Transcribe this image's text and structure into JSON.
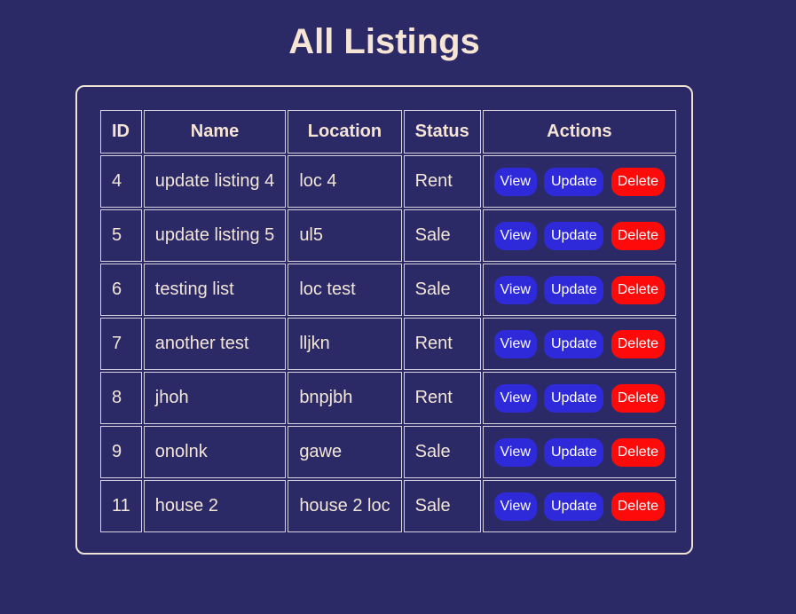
{
  "page": {
    "title": "All Listings"
  },
  "table": {
    "headers": {
      "id": "ID",
      "name": "Name",
      "location": "Location",
      "status": "Status",
      "actions": "Actions"
    },
    "buttons": {
      "view": "View",
      "update": "Update",
      "delete": "Delete"
    },
    "rows": [
      {
        "id": "4",
        "name": "update listing 4",
        "location": "loc 4",
        "status": "Rent"
      },
      {
        "id": "5",
        "name": "update listing 5",
        "location": "ul5",
        "status": "Sale"
      },
      {
        "id": "6",
        "name": "testing list",
        "location": "loc test",
        "status": "Sale"
      },
      {
        "id": "7",
        "name": "another test",
        "location": "lljkn",
        "status": "Rent"
      },
      {
        "id": "8",
        "name": "jhoh",
        "location": "bnpjbh",
        "status": "Rent"
      },
      {
        "id": "9",
        "name": "onolnk",
        "location": "gawe",
        "status": "Sale"
      },
      {
        "id": "11",
        "name": "house 2",
        "location": "house 2 loc",
        "status": "Sale"
      }
    ]
  },
  "colors": {
    "background": "#2b2a66",
    "primary_button": "#2e2ad9",
    "danger_button": "#ff0a0a",
    "text": "#f3e6d8"
  }
}
